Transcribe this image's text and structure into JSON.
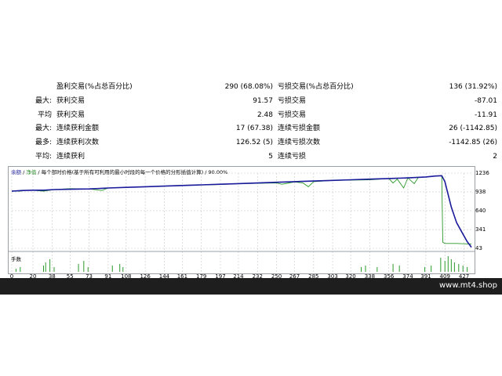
{
  "stats": [
    {
      "label": "",
      "name": "盈利交易(%占总百分比)",
      "value": "290 (68.08%)",
      "name2": "亏损交易(%占总百分比)",
      "value2": "136 (31.92%)"
    },
    {
      "label": "最大:",
      "name": "获利交易",
      "value": "91.57",
      "name2": "亏损交易",
      "value2": "-87.01"
    },
    {
      "label": "平均",
      "name": "获利交易",
      "value": "2.48",
      "name2": "亏损交易",
      "value2": "-11.91"
    },
    {
      "label": "最大:",
      "name": "连续获利金额",
      "value": "17 (67.38)",
      "name2": "连续亏损金额",
      "value2": "26 (-1142.85)"
    },
    {
      "label": "最多:",
      "name": "连续获利次数",
      "value": "126.52 (5)",
      "name2": "连续亏损次数",
      "value2": "-1142.85 (26)"
    },
    {
      "label": "平均:",
      "name": "连续获利",
      "value": "5",
      "name2": "连续亏损",
      "value2": "2"
    }
  ],
  "chart": {
    "legend_balance": "余额",
    "legend_sep": " / ",
    "legend_equity": "净值",
    "legend_rest": " / 每个部时价格(基于所有可利用的最小时段的每一个价格的分形插值计算) / 90.00%",
    "volume_label": "手数",
    "y_ticks": [
      "1236",
      "938",
      "640",
      "341",
      "43"
    ],
    "x_ticks": [
      "0",
      "20",
      "38",
      "55",
      "73",
      "91",
      "108",
      "126",
      "144",
      "161",
      "179",
      "197",
      "214",
      "232",
      "250",
      "267",
      "285",
      "303",
      "320",
      "338",
      "356",
      "374",
      "391",
      "409",
      "427"
    ],
    "colors": {
      "balance": "#1a1a9c",
      "equity": "#2a9a2a",
      "grid": "#c8c8c8",
      "volume": "#2a9a2a"
    }
  },
  "chart_data": {
    "type": "line",
    "x_range": [
      0,
      434
    ],
    "y_range": [
      43,
      1236
    ],
    "series": [
      {
        "name": "余额",
        "points": [
          [
            0,
            950
          ],
          [
            10,
            960
          ],
          [
            20,
            965
          ],
          [
            30,
            965
          ],
          [
            40,
            975
          ],
          [
            55,
            980
          ],
          [
            73,
            985
          ],
          [
            91,
            1000
          ],
          [
            108,
            1010
          ],
          [
            126,
            1020
          ],
          [
            144,
            1030
          ],
          [
            161,
            1040
          ],
          [
            179,
            1050
          ],
          [
            197,
            1060
          ],
          [
            214,
            1070
          ],
          [
            232,
            1080
          ],
          [
            250,
            1090
          ],
          [
            267,
            1100
          ],
          [
            285,
            1110
          ],
          [
            303,
            1120
          ],
          [
            320,
            1130
          ],
          [
            338,
            1140
          ],
          [
            356,
            1150
          ],
          [
            374,
            1160
          ],
          [
            391,
            1175
          ],
          [
            400,
            1190
          ],
          [
            406,
            1195
          ],
          [
            409,
            1100
          ],
          [
            415,
            700
          ],
          [
            420,
            450
          ],
          [
            425,
            300
          ],
          [
            430,
            150
          ],
          [
            434,
            60
          ]
        ]
      },
      {
        "name": "净值",
        "points": [
          [
            0,
            955
          ],
          [
            8,
            950
          ],
          [
            12,
            960
          ],
          [
            20,
            965
          ],
          [
            30,
            950
          ],
          [
            40,
            975
          ],
          [
            55,
            990
          ],
          [
            73,
            985
          ],
          [
            85,
            960
          ],
          [
            91,
            1000
          ],
          [
            108,
            1010
          ],
          [
            126,
            1020
          ],
          [
            144,
            1030
          ],
          [
            161,
            1045
          ],
          [
            179,
            1050
          ],
          [
            197,
            1055
          ],
          [
            214,
            1070
          ],
          [
            232,
            1075
          ],
          [
            250,
            1080
          ],
          [
            255,
            1060
          ],
          [
            260,
            1075
          ],
          [
            267,
            1095
          ],
          [
            275,
            1080
          ],
          [
            280,
            1020
          ],
          [
            285,
            1100
          ],
          [
            303,
            1120
          ],
          [
            320,
            1125
          ],
          [
            338,
            1130
          ],
          [
            356,
            1150
          ],
          [
            360,
            1080
          ],
          [
            364,
            1140
          ],
          [
            370,
            1000
          ],
          [
            374,
            1160
          ],
          [
            380,
            1070
          ],
          [
            384,
            1170
          ],
          [
            391,
            1175
          ],
          [
            400,
            1190
          ],
          [
            406,
            1195
          ],
          [
            407,
            140
          ],
          [
            409,
            120
          ],
          [
            420,
            120
          ],
          [
            434,
            110
          ]
        ]
      }
    ]
  }
}
